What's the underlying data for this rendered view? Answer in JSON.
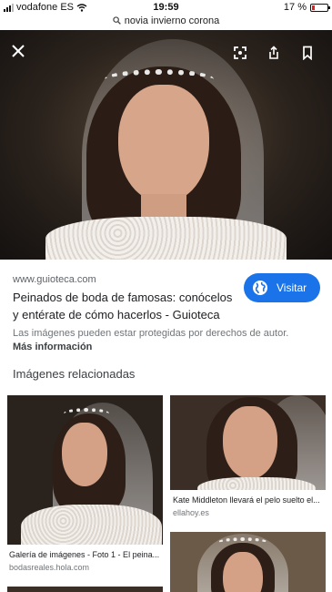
{
  "status": {
    "carrier": "vodafone ES",
    "time": "19:59",
    "battery": "17 %",
    "battery_level": 0.17
  },
  "url_bar": {
    "query": "novia invierno corona"
  },
  "hero": {
    "close_icon": "close-icon",
    "lens_icon": "lens-icon",
    "share_icon": "share-icon",
    "bookmark_icon": "bookmark-icon"
  },
  "result": {
    "source": "www.guioteca.com",
    "title": "Peinados de boda de famosas: conócelos y entérate de cómo hacerlos - Guioteca",
    "visit_label": "Visitar",
    "disclaimer": "Las imágenes pueden estar protegidas por derechos de autor.",
    "more_info": "Más información"
  },
  "related": {
    "heading": "Imágenes relacionadas",
    "items": [
      {
        "caption": "Galería de imágenes - Foto 1 - El peina...",
        "source": "bodasreales.hola.com"
      },
      {
        "caption": "Kate Middleton llevará el pelo suelto el...",
        "source": "ellahoy.es"
      }
    ]
  },
  "colors": {
    "accent": "#1a73e8",
    "battery_low": "#e02020"
  }
}
